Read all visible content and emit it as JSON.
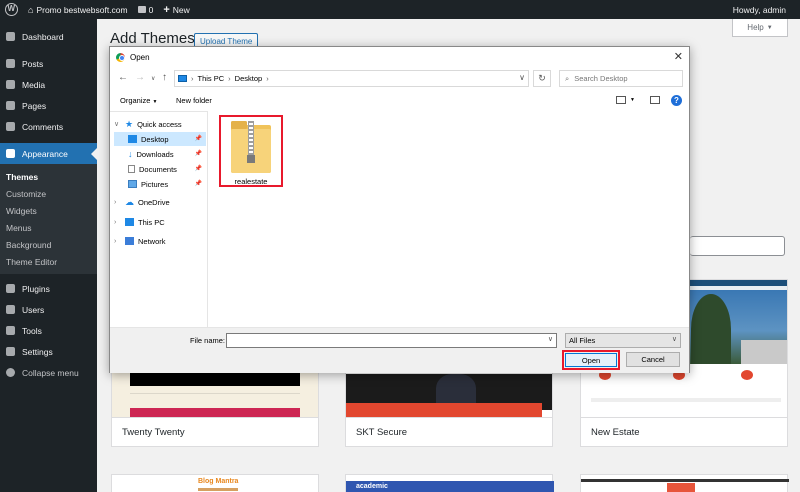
{
  "adminbar": {
    "site_name": "Promo bestwebsoft.com",
    "comments_count": "0",
    "new_label": "New",
    "howdy": "Howdy, admin"
  },
  "sidebar": {
    "items": [
      {
        "label": "Dashboard",
        "icon": "dashboard-icon"
      },
      {
        "label": "Posts",
        "icon": "pin-icon"
      },
      {
        "label": "Media",
        "icon": "media-icon"
      },
      {
        "label": "Pages",
        "icon": "page-icon"
      },
      {
        "label": "Comments",
        "icon": "comment-icon"
      },
      {
        "label": "Appearance",
        "icon": "brush-icon"
      }
    ],
    "submenu": [
      "Themes",
      "Customize",
      "Widgets",
      "Menus",
      "Background",
      "Theme Editor"
    ],
    "items_after": [
      {
        "label": "Plugins",
        "icon": "plug-icon"
      },
      {
        "label": "Users",
        "icon": "user-icon"
      },
      {
        "label": "Tools",
        "icon": "wrench-icon"
      },
      {
        "label": "Settings",
        "icon": "settings-icon"
      }
    ],
    "collapse_label": "Collapse menu"
  },
  "main": {
    "title": "Add Themes",
    "upload_label": "Upload Theme",
    "help_label": "Help",
    "themes": [
      "Twenty Twenty",
      "SKT Secure",
      "New Estate"
    ],
    "lower_theme_text": [
      "Blog Mantra",
      "academic"
    ]
  },
  "dialog": {
    "title": "Open",
    "path": [
      "This PC",
      "Desktop"
    ],
    "search_placeholder": "Search Desktop",
    "organize_label": "Organize",
    "new_folder_label": "New folder",
    "nav": {
      "quick_access": "Quick access",
      "desktop": "Desktop",
      "downloads": "Downloads",
      "documents": "Documents",
      "pictures": "Pictures",
      "onedrive": "OneDrive",
      "this_pc": "This PC",
      "network": "Network"
    },
    "file": {
      "name": "realestate"
    },
    "file_name_label": "File name:",
    "file_name_value": "",
    "filter": "All Files",
    "open_label": "Open",
    "cancel_label": "Cancel"
  }
}
